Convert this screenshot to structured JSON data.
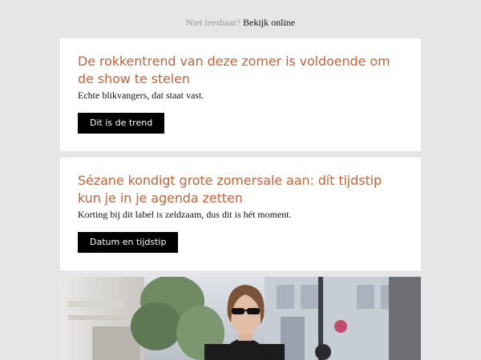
{
  "topbar": {
    "prefix": "Niet leesbaar?",
    "link_label": "Bekijk online"
  },
  "articles": [
    {
      "title": "De rokkentrend van deze zomer is voldoende om de show te stelen",
      "subtitle": "Echte blikvangers, dat staat vast.",
      "button_label": "Dit is de trend"
    },
    {
      "title": "Sézane kondigt grote zomersale aan: dít tijdstip kun je in je agenda zetten",
      "subtitle": "Korting bij dit label is zeldzaam, dus dit is hét moment.",
      "button_label": "Datum en tijdstip"
    }
  ],
  "colors": {
    "page_background": "#e6e6e8",
    "card_background": "#ffffff",
    "headline": "#c0643a",
    "button_background": "#000000",
    "button_text": "#ffffff"
  },
  "hero_image": {
    "subject": "woman-in-sunglasses-street-style-photo"
  }
}
